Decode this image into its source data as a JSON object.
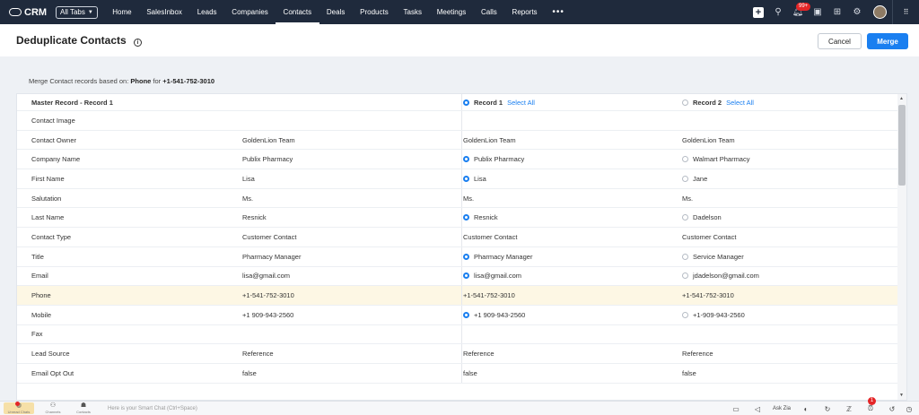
{
  "nav": {
    "app_name": "CRM",
    "all_tabs": "All Tabs",
    "tabs": [
      "Home",
      "SalesInbox",
      "Leads",
      "Companies",
      "Contacts",
      "Deals",
      "Products",
      "Tasks",
      "Meetings",
      "Calls",
      "Reports"
    ],
    "active_tab": "Contacts",
    "more": "•••",
    "notification_badge": "99+"
  },
  "header": {
    "title": "Deduplicate Contacts",
    "cancel_label": "Cancel",
    "merge_label": "Merge"
  },
  "criteria": {
    "prefix": "Merge Contact records based on:",
    "field": "Phone",
    "for_text": "for",
    "value": "+1-541-752-3010"
  },
  "table": {
    "header": {
      "master": "Master Record - Record 1",
      "record1": "Record 1",
      "record2": "Record 2",
      "select_all": "Select All"
    },
    "rows": [
      {
        "label": "Contact Image",
        "master": "",
        "r1": "",
        "r2": "",
        "radio": false
      },
      {
        "label": "Contact Owner",
        "master": "GoldenLion Team",
        "r1": "GoldenLion Team",
        "r2": "GoldenLion Team",
        "radio": false
      },
      {
        "label": "Company Name",
        "master": "Publix Pharmacy",
        "r1": "Publix Pharmacy",
        "r2": "Walmart Pharmacy",
        "radio": true
      },
      {
        "label": "First Name",
        "master": "Lisa",
        "r1": "Lisa",
        "r2": "Jane",
        "radio": true
      },
      {
        "label": "Salutation",
        "master": "Ms.",
        "r1": "Ms.",
        "r2": "Ms.",
        "radio": false
      },
      {
        "label": "Last Name",
        "master": "Resnick",
        "r1": "Resnick",
        "r2": "Dadelson",
        "radio": true
      },
      {
        "label": "Contact Type",
        "master": "Customer Contact",
        "r1": "Customer Contact",
        "r2": "Customer Contact",
        "radio": false
      },
      {
        "label": "Title",
        "master": "Pharmacy Manager",
        "r1": "Pharmacy Manager",
        "r2": "Service Manager",
        "radio": true
      },
      {
        "label": "Email",
        "master": "lisa@gmail.com",
        "r1": "lisa@gmail.com",
        "r2": "jdadelson@gmail.com",
        "radio": true
      },
      {
        "label": "Phone",
        "master": "+1-541-752-3010",
        "r1": "+1-541-752-3010",
        "r2": "+1-541-752-3010",
        "radio": false,
        "highlight": true
      },
      {
        "label": "Mobile",
        "master": "+1 909-943-2560",
        "r1": "+1 909-943-2560",
        "r2": "+1-909-943-2560",
        "radio": true
      },
      {
        "label": "Fax",
        "master": "",
        "r1": "",
        "r2": "",
        "radio": false
      },
      {
        "label": "Lead Source",
        "master": "Reference",
        "r1": "Reference",
        "r2": "Reference",
        "radio": false
      },
      {
        "label": "Email Opt Out",
        "master": "false",
        "r1": "false",
        "r2": "false",
        "radio": false
      }
    ]
  },
  "bottom": {
    "unread": "Unread Chats",
    "channels": "Channels",
    "contacts": "Contacts",
    "smart_chat": "Here is your Smart Chat (Ctrl+Space)",
    "ask_zia": "Ask Zia",
    "alarm_badge": "1"
  }
}
